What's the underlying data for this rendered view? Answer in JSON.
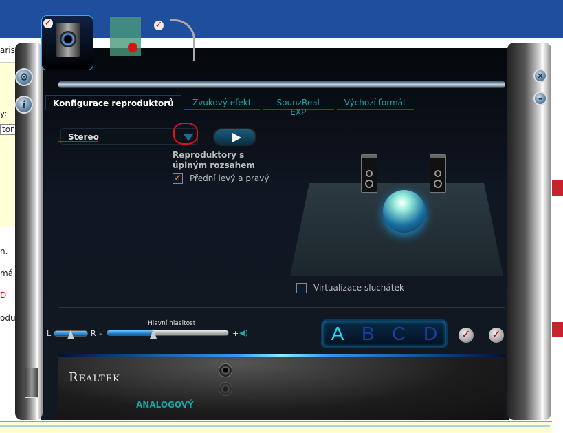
{
  "background": {
    "left_fragments": [
      "aris",
      "y:",
      "tor",
      "n.",
      "má",
      "D",
      "odu"
    ]
  },
  "window": {
    "tabs": [
      {
        "label": "Konfigurace reproduktorů",
        "active": true
      },
      {
        "label": "Zvukový efekt",
        "active": false
      },
      {
        "label": "SounzReal EXP",
        "active": false
      },
      {
        "label": "Výchozí formát",
        "active": false
      }
    ],
    "speaker_config": {
      "selected": "Stereo"
    },
    "full_range": {
      "title": "Reproduktory s úplným rozsahem",
      "front_lr_label": "Přední levý a pravý",
      "front_lr_checked": true
    },
    "headphone_virtualization": {
      "label": "Virtualizace sluchátek",
      "checked": false
    },
    "volume": {
      "title": "Hlavní hlasitost",
      "balance_left": "L",
      "balance_right": "R",
      "minus": "–",
      "plus": "+",
      "level_percent": 38,
      "balance_percent": 50
    },
    "profiles": [
      "A",
      "B",
      "C",
      "D"
    ],
    "active_profile": "A",
    "brand": "Realtek",
    "connector_label": "ANALOGOVÝ",
    "accent_color": "#1aa5a5"
  }
}
